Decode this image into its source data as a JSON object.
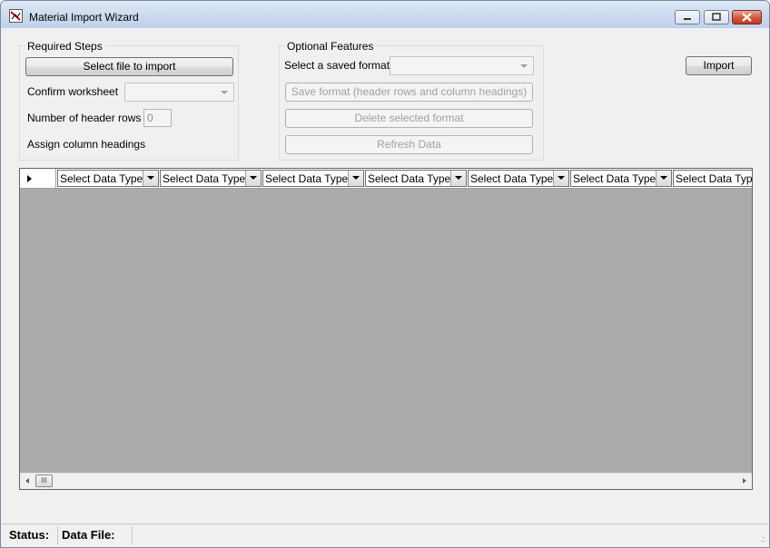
{
  "window": {
    "title": "Material Import Wizard"
  },
  "required_steps": {
    "title": "Required Steps",
    "select_file_button": "Select file to import",
    "confirm_worksheet_label": "Confirm worksheet",
    "confirm_worksheet_value": "",
    "header_rows_label": "Number of header rows",
    "header_rows_value": "0",
    "assign_headings_label": "Assign column headings"
  },
  "optional_features": {
    "title": "Optional Features",
    "saved_format_label": "Select a saved format",
    "saved_format_value": "",
    "save_format_button": "Save format (header rows and column headings)",
    "delete_format_button": "Delete selected format",
    "refresh_button": "Refresh Data"
  },
  "import_button": "Import",
  "grid": {
    "columns": [
      "Select Data Type",
      "Select Data Type",
      "Select Data Type",
      "Select Data Type",
      "Select Data Type",
      "Select Data Type",
      "Select Data Type"
    ],
    "scroll_thumb": "III"
  },
  "status": {
    "status_label": "Status:",
    "data_file_label": "Data File:"
  },
  "colors": {
    "grid_background": "#ababab",
    "window_background": "#f0f0f0"
  }
}
